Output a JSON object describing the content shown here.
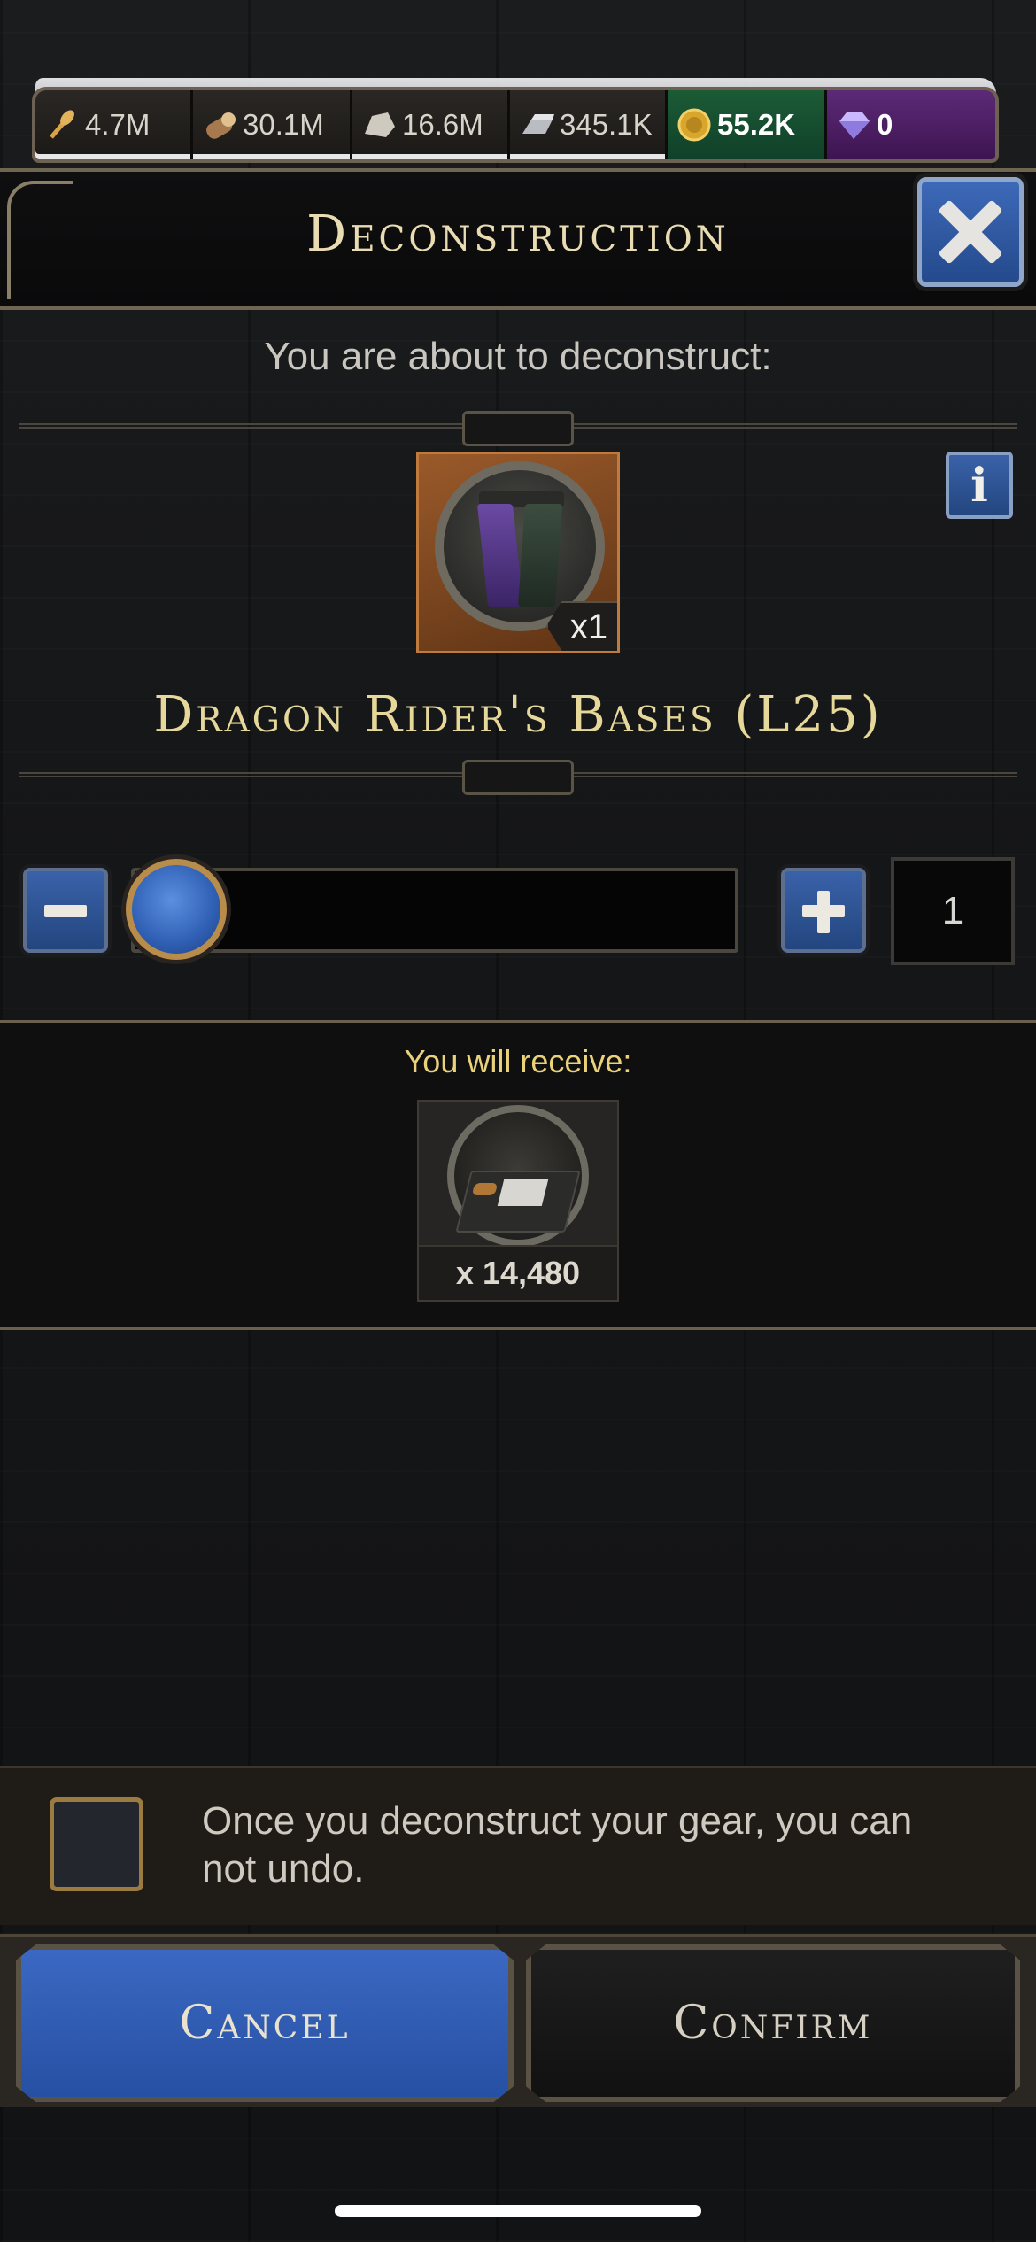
{
  "resources": [
    {
      "icon": "wheat-icon",
      "value": "4.7M"
    },
    {
      "icon": "wood-log-icon",
      "value": "30.1M"
    },
    {
      "icon": "stone-icon",
      "value": "16.6M"
    },
    {
      "icon": "iron-ingot-icon",
      "value": "345.1K"
    },
    {
      "icon": "gold-coin-icon",
      "value": "55.2K"
    },
    {
      "icon": "gem-icon",
      "value": "0"
    }
  ],
  "header": {
    "title": "Deconstruction"
  },
  "subtitle": "You are about to deconstruct:",
  "item": {
    "name": "Dragon Rider's Bases (L25)",
    "quantity": "x1",
    "icon": "pants-icon"
  },
  "slider": {
    "value": "1",
    "fraction": 0
  },
  "receive": {
    "label": "You will receive:",
    "amount": "x 14,480",
    "icon": "crafting-materials-icon"
  },
  "warning": {
    "text": "Once you deconstruct your gear, you can not undo."
  },
  "buttons": {
    "cancel": "Cancel",
    "confirm": "Confirm"
  },
  "colors": {
    "accent_blue": "#2f5fb3",
    "gold_text": "#e6d89a",
    "receive_label": "#e9d27a"
  }
}
